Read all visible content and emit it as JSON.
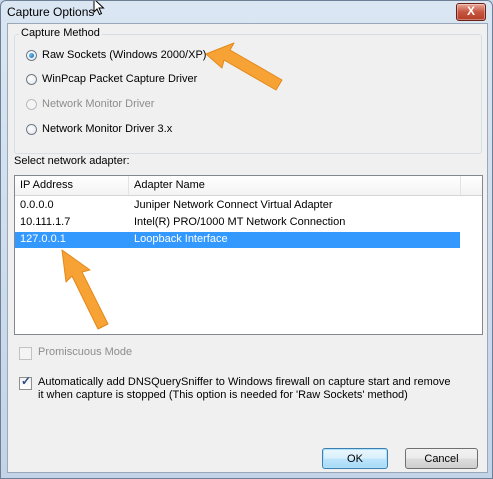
{
  "window": {
    "title": "Capture Options",
    "close_glyph": "X"
  },
  "capture_method": {
    "group_label": "Capture Method",
    "options": [
      {
        "label": "Raw Sockets (Windows 2000/XP)",
        "checked": true,
        "enabled": true
      },
      {
        "label": "WinPcap Packet Capture Driver",
        "checked": false,
        "enabled": true
      },
      {
        "label": "Network Monitor Driver",
        "checked": false,
        "enabled": false
      },
      {
        "label": "Network Monitor Driver 3.x",
        "checked": false,
        "enabled": true
      }
    ]
  },
  "adapter": {
    "label": "Select network adapter:",
    "columns": [
      "IP Address",
      "Adapter Name"
    ],
    "rows": [
      {
        "ip": "0.0.0.0",
        "name": "Juniper Network Connect Virtual Adapter",
        "selected": false
      },
      {
        "ip": "10.111.1.7",
        "name": "Intel(R) PRO/1000 MT Network Connection",
        "selected": false
      },
      {
        "ip": "127.0.0.1",
        "name": "Loopback Interface",
        "selected": true
      }
    ]
  },
  "promiscuous": {
    "label": "Promiscuous Mode",
    "checked": false,
    "enabled": false
  },
  "firewall": {
    "label": "Automatically add DNSQuerySniffer to Windows firewall on capture start and remove it when capture is stopped (This option is needed for 'Raw Sockets' method)",
    "checked": true
  },
  "buttons": {
    "ok": "OK",
    "cancel": "Cancel"
  },
  "colors": {
    "selection": "#3399ff",
    "arrow": "#f7a234"
  }
}
